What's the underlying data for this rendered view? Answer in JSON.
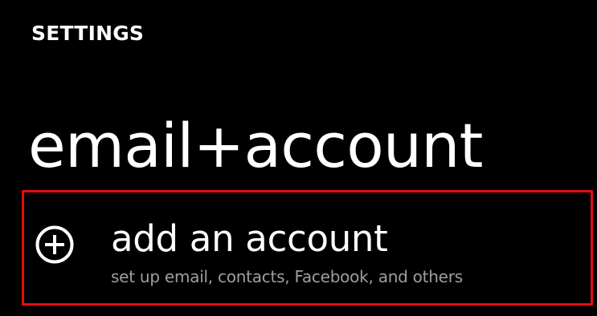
{
  "header": {
    "section": "SETTINGS",
    "title": "email+account"
  },
  "add_account": {
    "title": "add an account",
    "subtitle": "set up email, contacts, Facebook, and others",
    "icon": "plus-circle-icon"
  },
  "colors": {
    "background": "#000000",
    "primary_text": "#ffffff",
    "secondary_text": "#9e9e9e",
    "highlight_border": "#e50b0b"
  }
}
